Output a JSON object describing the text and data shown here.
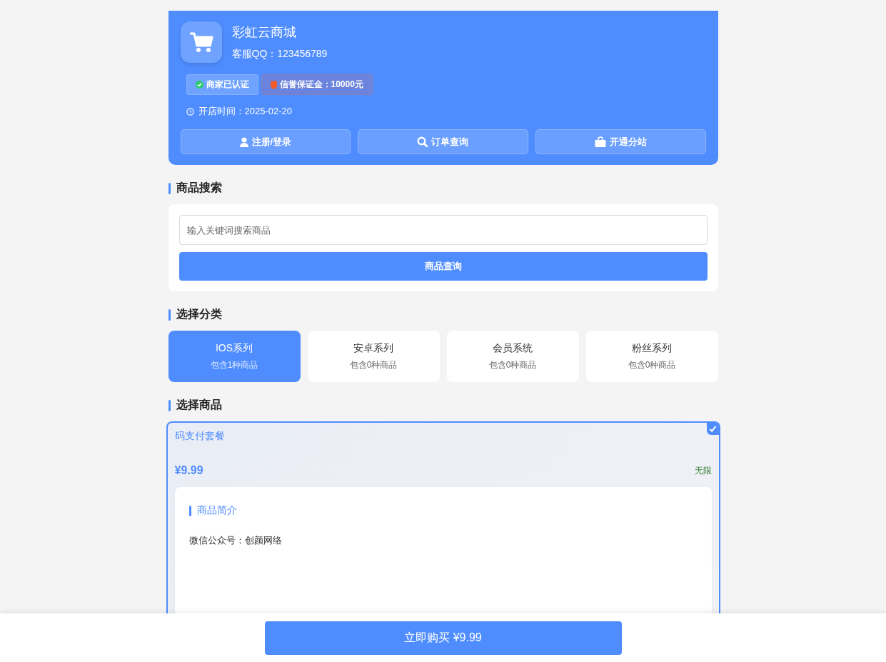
{
  "shop": {
    "name": "彩虹云商城",
    "qq": "客服QQ：123456789",
    "badges": [
      {
        "kind": "verified",
        "label": "商家已认证"
      },
      {
        "kind": "deposit",
        "label": "信誉保证金：10000元"
      }
    ],
    "open_time": "开店时间：2025-02-20",
    "actions": [
      {
        "kind": "user",
        "label": "注册/登录"
      },
      {
        "kind": "search",
        "label": "订单查询"
      },
      {
        "kind": "bag",
        "label": "开通分站"
      }
    ]
  },
  "search": {
    "title": "商品搜索",
    "placeholder": "输入关键词搜索商品",
    "button": "商品查询"
  },
  "categories": {
    "title": "选择分类",
    "items": [
      {
        "name": "IOS系列",
        "count": "包含1种商品",
        "selected": true
      },
      {
        "name": "安卓系列",
        "count": "包含0种商品",
        "selected": false
      },
      {
        "name": "会员系统",
        "count": "包含0种商品",
        "selected": false
      },
      {
        "name": "粉丝系列",
        "count": "包含0种商品",
        "selected": false
      }
    ]
  },
  "products": {
    "title": "选择商品",
    "items": [
      {
        "name": "码支付套餐",
        "price": "¥9.99",
        "stock": "无限",
        "selected": true,
        "intro_title": "商品简介",
        "intro_text": "微信公众号：创颜网络"
      }
    ]
  },
  "buy_button": "立即购买 ¥9.99"
}
